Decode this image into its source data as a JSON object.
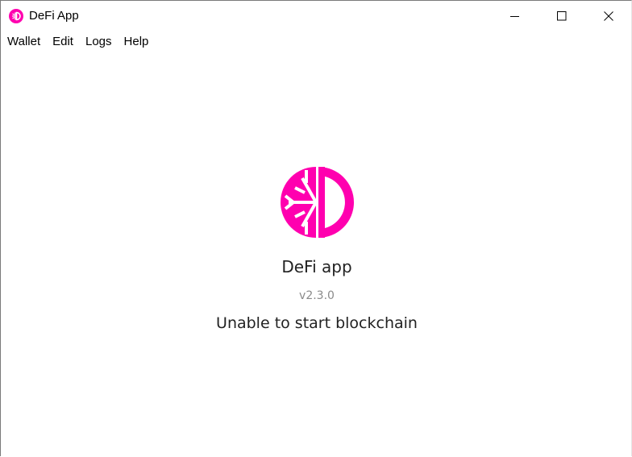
{
  "window": {
    "title": "DeFi App",
    "controls": {
      "minimize_icon": "minimize-icon",
      "maximize_icon": "maximize-icon",
      "close_icon": "close-icon"
    }
  },
  "menu": {
    "items": [
      {
        "label": "Wallet"
      },
      {
        "label": "Edit"
      },
      {
        "label": "Logs"
      },
      {
        "label": "Help"
      }
    ]
  },
  "splash": {
    "logo_icon": "defichain-logo-icon",
    "app_name": "DeFi app",
    "version": "v2.3.0",
    "status": "Unable to start blockchain"
  },
  "colors": {
    "brand": "#ff00af",
    "text": "#222222",
    "muted": "#8a8a8a"
  }
}
